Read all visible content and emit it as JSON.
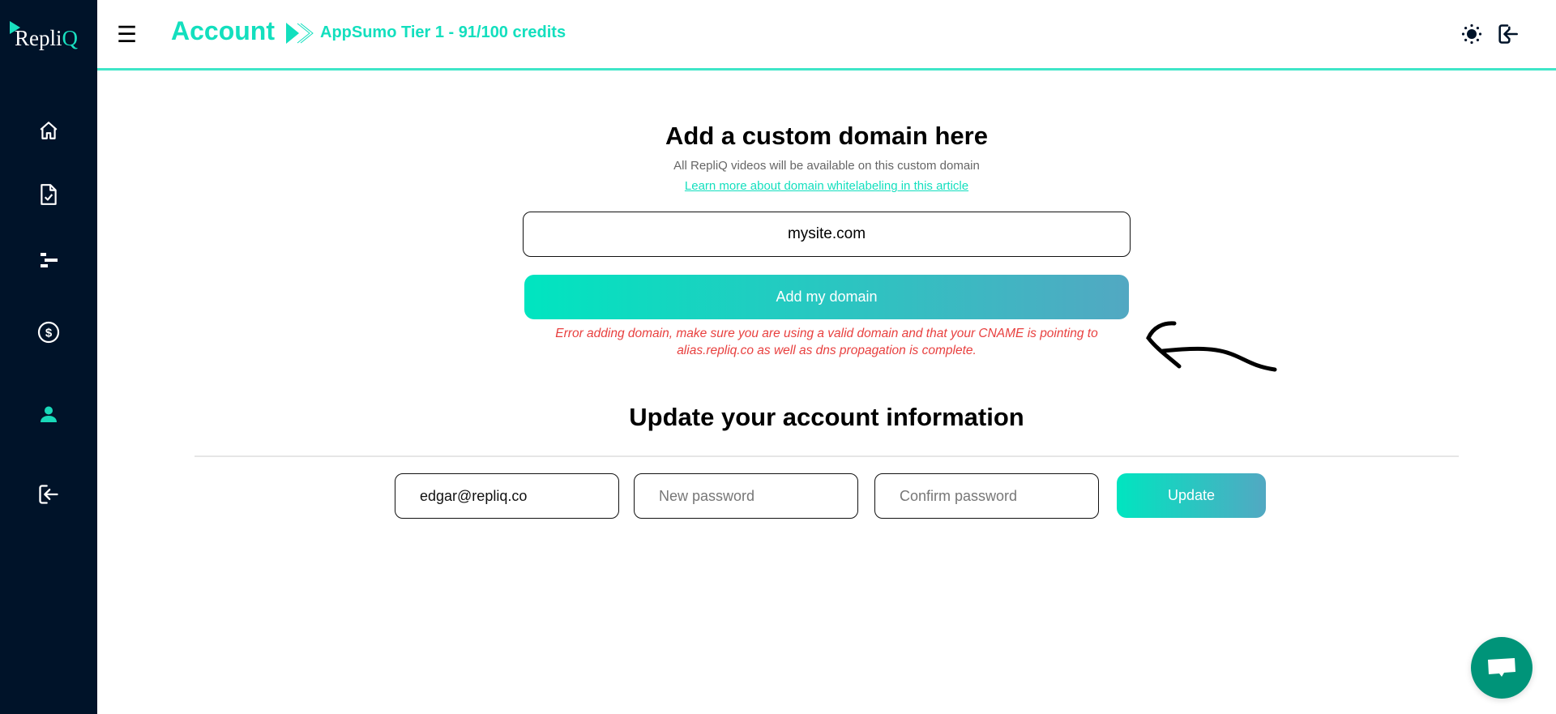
{
  "brand": {
    "logo_text": "Repli",
    "logo_q": "Q",
    "accent": "#13dfbe",
    "sidebar_bg": "#001329"
  },
  "header": {
    "title": "Account",
    "plan": "AppSumo Tier 1 - 91/100 credits"
  },
  "sidebar": {
    "items": [
      {
        "icon": "home-icon"
      },
      {
        "icon": "document-check-icon"
      },
      {
        "icon": "timeline-icon"
      },
      {
        "icon": "dollar-icon"
      },
      {
        "icon": "user-icon",
        "active": true
      },
      {
        "icon": "logout-icon"
      }
    ]
  },
  "domain": {
    "title": "Add a custom domain here",
    "subtitle": "All RepliQ videos will be available on this custom domain",
    "link": "Learn more about domain whitelabeling in this article",
    "value": "mysite.com",
    "button": "Add my domain",
    "error_line1": "Error adding domain, make sure you are using a valid domain and that your CNAME is pointing to",
    "error_line2": "alias.repliq.co as well as dns propagation is complete.",
    "error_color": "#e8403f"
  },
  "account": {
    "title": "Update your account information",
    "email": "edgar@repliq.co",
    "new_password_placeholder": "New password",
    "confirm_password_placeholder": "Confirm password",
    "button": "Update"
  }
}
